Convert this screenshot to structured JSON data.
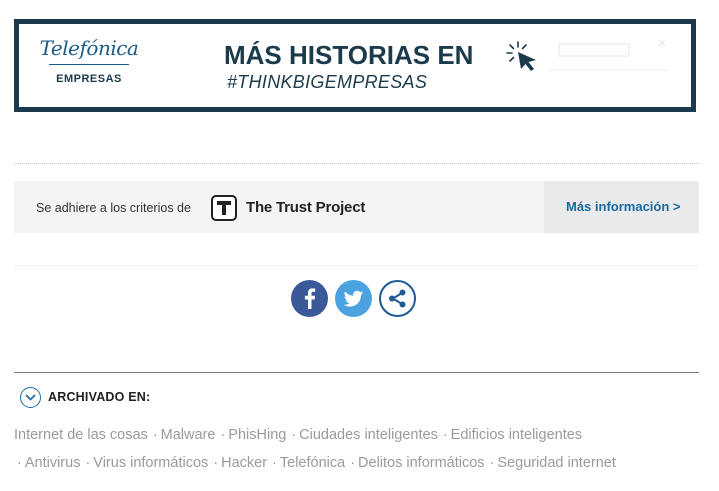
{
  "banner": {
    "logo_word": "Telefónica",
    "logo_sub": "EMPRESAS",
    "title": "MÁS HISTORIAS EN",
    "subtitle": "#THINKBIGEMPRESAS",
    "border_color": "#1b3a4b"
  },
  "trust": {
    "text": "Se adhiere a los criterios de",
    "name": "The Trust Project",
    "more_link": "Más información >",
    "link_color": "#1c69a0"
  },
  "social": {
    "buttons": [
      {
        "icon": "facebook-icon",
        "color": "#3b5998"
      },
      {
        "icon": "twitter-icon",
        "color": "#4aa3e0"
      },
      {
        "icon": "share-icon",
        "color": "#1f5a94"
      }
    ]
  },
  "archived": {
    "label": "ARCHIVADO EN:"
  },
  "tags": {
    "line1": [
      "Internet de las cosas",
      "Malware",
      "PhisHing",
      "Ciudades inteligentes",
      "Edificios inteligentes"
    ],
    "line2": [
      "Antivirus",
      "Virus informáticos",
      "Hacker",
      "Telefónica",
      "Delitos informáticos",
      "Seguridad internet"
    ]
  }
}
